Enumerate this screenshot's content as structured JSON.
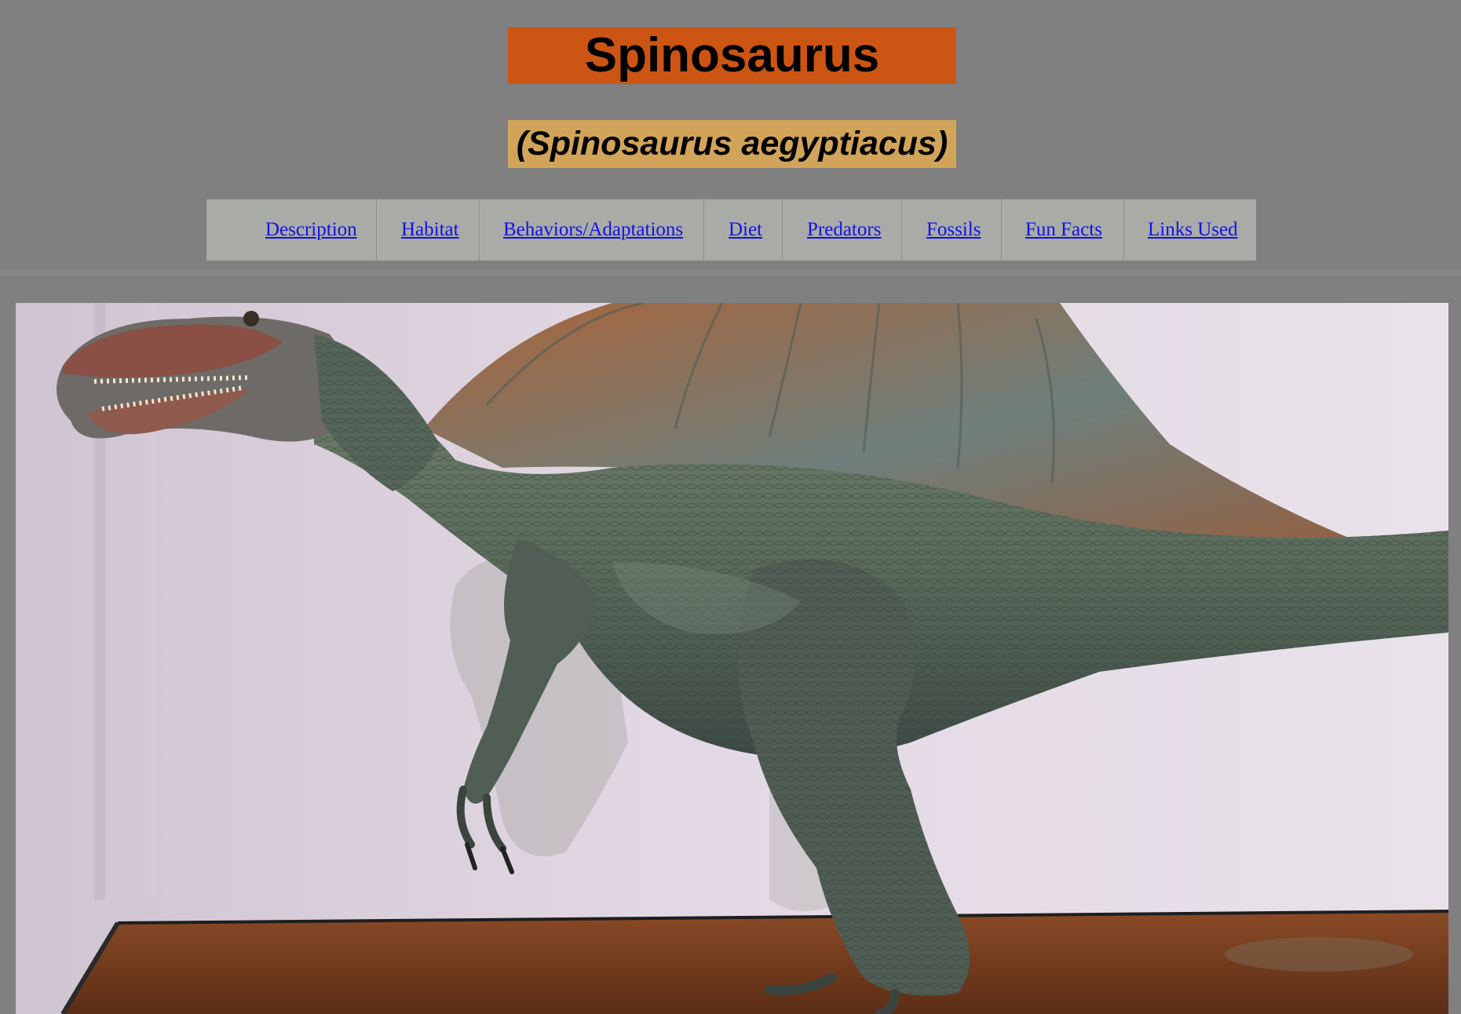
{
  "header": {
    "title": "Spinosaurus",
    "subtitle": "(Spinosaurus aegyptiacus)"
  },
  "nav": {
    "items": [
      {
        "label": "Description"
      },
      {
        "label": "Habitat"
      },
      {
        "label": "Behaviors/Adaptations"
      },
      {
        "label": "Diet"
      },
      {
        "label": "Predators"
      },
      {
        "label": "Fossils"
      },
      {
        "label": "Fun Facts"
      },
      {
        "label": "Links Used"
      }
    ]
  },
  "colors": {
    "page_background": "#808080",
    "title_background": "#cc5514",
    "subtitle_background": "#d1a45a",
    "nav_background": "#a9aba7",
    "link_color": "#1212e8"
  },
  "hero_image": {
    "subject": "spinosaurus-model-photo"
  }
}
